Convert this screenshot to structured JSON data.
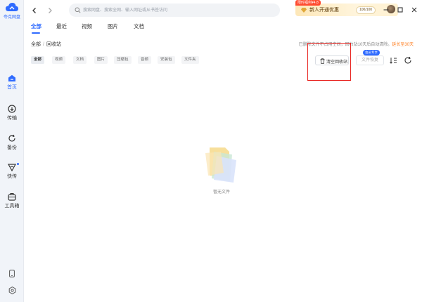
{
  "app": {
    "name": "夸克网盘"
  },
  "sidebar": {
    "items": [
      {
        "label": "首页",
        "icon": "home-icon",
        "active": true
      },
      {
        "label": "传输",
        "icon": "transfer-icon",
        "active": false
      },
      {
        "label": "备份",
        "icon": "backup-icon",
        "active": false
      },
      {
        "label": "快传",
        "icon": "quick-send-icon",
        "active": false,
        "dot": true
      },
      {
        "label": "工具箱",
        "icon": "toolbox-icon",
        "active": false
      }
    ],
    "bottom_icons": [
      "phone-icon",
      "settings-icon"
    ]
  },
  "topbar": {
    "search_placeholder": "搜索网盘、搜索全网、输入网址或从书签访问",
    "promo": {
      "tag": "限时福利¥4.8",
      "text": "新人开通优惠",
      "count": "100/100"
    }
  },
  "tabs": [
    {
      "label": "全部",
      "active": true
    },
    {
      "label": "最近",
      "active": false
    },
    {
      "label": "视频",
      "active": false
    },
    {
      "label": "图片",
      "active": false
    },
    {
      "label": "文档",
      "active": false
    }
  ],
  "breadcrumb": {
    "root": "全部",
    "current": "回收站"
  },
  "notice": {
    "text": "已删除文件不占用空间，回收站10天后自动清除。",
    "link": "延长至30天"
  },
  "filters": [
    {
      "label": "全部",
      "active": true
    },
    {
      "label": "视频",
      "active": false
    },
    {
      "label": "文档",
      "active": false
    },
    {
      "label": "图片",
      "active": false
    },
    {
      "label": "压缩包",
      "active": false
    },
    {
      "label": "音频",
      "active": false
    },
    {
      "label": "安装包",
      "active": false
    },
    {
      "label": "文件夹",
      "active": false
    }
  ],
  "actions": {
    "empty_trash": "清空回收站",
    "restore": "文件恢复",
    "vip_badge": "会员专享"
  },
  "empty_state": {
    "text": "暂无文件"
  },
  "colors": {
    "accent": "#2f6bff",
    "highlight": "#e8231f",
    "promo": "#ff4b2f",
    "link": "#ff7a1a"
  }
}
